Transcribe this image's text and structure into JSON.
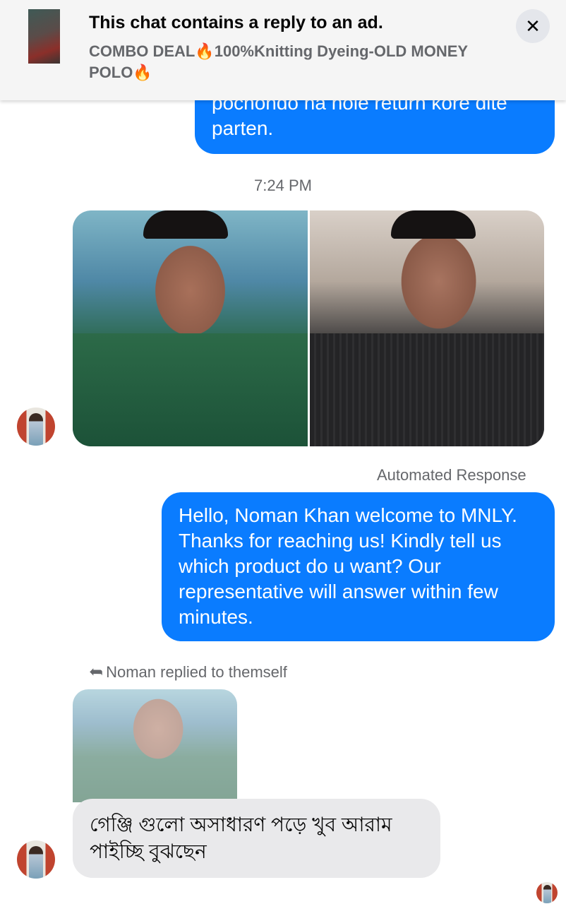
{
  "ad_banner": {
    "title": "This chat contains a reply to an ad.",
    "subtitle": "COMBO DEAL🔥100%Knitting Dyeing-OLD MONEY POLO🔥",
    "close_symbol": "✕"
  },
  "messages": {
    "previous_outgoing": {
      "line1": "pochondo na hole return kore dite",
      "line2": "parten."
    },
    "timestamp": "7:24 PM",
    "automated_label": "Automated Response",
    "welcome_text": "Hello,  Noman Khan welcome to MNLY. Thanks for reaching us! Kindly tell us which product do u want? Our representative will answer within few minutes.",
    "reply_context": "Noman replied to themself",
    "incoming_text": "গেঞ্জি গুলো অসাধারণ পড়ে খুব আরাম পাইচ্ছি বুঝছেন"
  },
  "icons": {
    "close": "close-icon",
    "reply": "reply-arrow-icon"
  },
  "colors": {
    "outgoing_bubble": "#0a7cff",
    "incoming_bubble": "#e9e9eb",
    "secondary_text": "#65676b"
  }
}
